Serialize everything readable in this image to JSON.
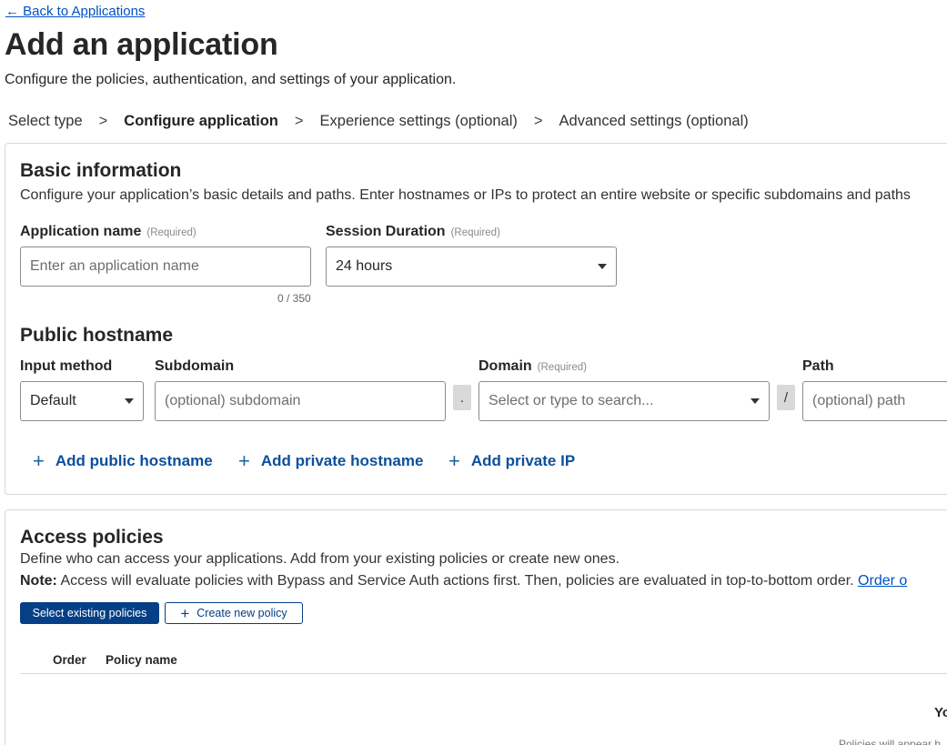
{
  "header": {
    "back_link": "← Back to Applications",
    "title": "Add an application",
    "subtitle": "Configure the policies, authentication, and settings of your application."
  },
  "stepper": {
    "steps": [
      {
        "label": "Select type"
      },
      {
        "label": "Configure application"
      },
      {
        "label": "Experience settings (optional)"
      },
      {
        "label": "Advanced settings (optional)"
      }
    ],
    "separator": ">",
    "active_step": "Configure application"
  },
  "basic_info": {
    "title": "Basic information",
    "description": "Configure your application’s basic details and paths. Enter hostnames or IPs to protect an entire website or specific subdomains and paths",
    "app_name": {
      "label": "Application name",
      "required": "(Required)",
      "placeholder": "Enter an application name",
      "value": "",
      "counter": "0 / 350"
    },
    "session_duration": {
      "label": "Session Duration",
      "required": "(Required)",
      "value": "24 hours"
    }
  },
  "public_hostname": {
    "title": "Public hostname",
    "input_method": {
      "label": "Input method",
      "value": "Default"
    },
    "subdomain": {
      "label": "Subdomain",
      "placeholder": "(optional) subdomain",
      "value": ""
    },
    "dot_separator": ".",
    "domain": {
      "label": "Domain",
      "required": "(Required)",
      "placeholder": "Select or type to search..."
    },
    "slash_separator": "/",
    "path": {
      "label": "Path",
      "placeholder": "(optional) path",
      "value": ""
    },
    "actions": {
      "add_public_hostname": "Add public hostname",
      "add_private_hostname": "Add private hostname",
      "add_private_ip": "Add private IP"
    }
  },
  "access_policies": {
    "title": "Access policies",
    "description": "Define who can access your applications. Add from your existing policies or create new ones.",
    "note_label": "Note:",
    "note_text": " Access will evaluate policies with Bypass and Service Auth actions first. Then, policies are evaluated in top-to-bottom order. ",
    "note_link": "Order o",
    "select_existing_button": "Select existing policies",
    "create_new_button": "Create new policy",
    "table": {
      "columns": [
        "Order",
        "Policy name"
      ],
      "empty_title": "Yo",
      "empty_sub": "Policies will appear h"
    }
  },
  "colors": {
    "link": "#0051c3",
    "primary_button": "#053f85",
    "border": "#d9d9d9"
  }
}
